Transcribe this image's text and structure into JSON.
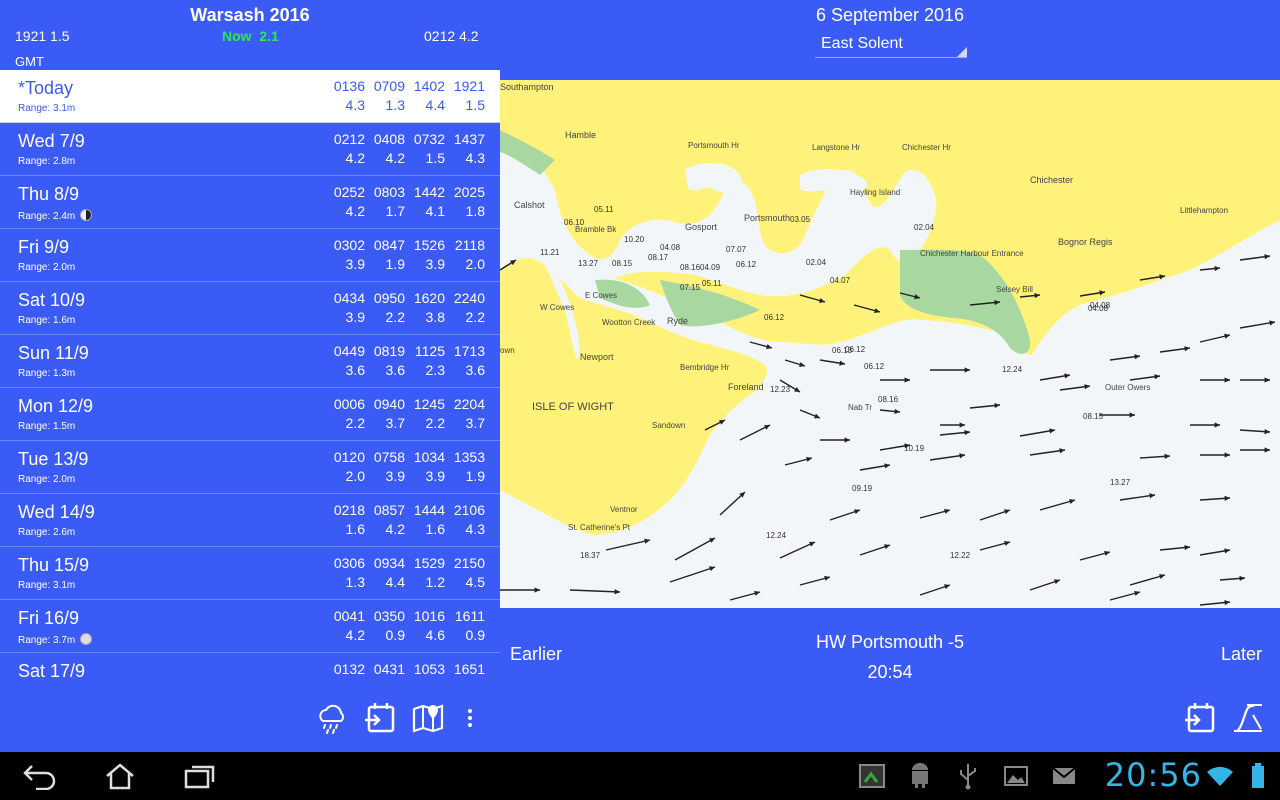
{
  "left": {
    "title": "Warsash 2016",
    "prev_tide": "1921  1.5",
    "now_label": "Now",
    "now_value": "2.1",
    "next_tide": "0212  4.2",
    "timezone": "GMT",
    "days": [
      {
        "name": "*Today",
        "range": "Range: 3.1m",
        "moon": "",
        "times": [
          "0136",
          "0709",
          "1402",
          "1921"
        ],
        "heights": [
          "4.3",
          "1.3",
          "4.4",
          "1.5"
        ]
      },
      {
        "name": "Wed 7/9",
        "range": "Range: 2.8m",
        "moon": "",
        "times": [
          "0212",
          "0408",
          "0732",
          "1437"
        ],
        "heights": [
          "4.2",
          "4.2",
          "1.5",
          "4.3"
        ]
      },
      {
        "name": "Thu 8/9",
        "range": "Range: 2.4m",
        "moon": "new",
        "times": [
          "0252",
          "0803",
          "1442",
          "2025"
        ],
        "heights": [
          "4.2",
          "1.7",
          "4.1",
          "1.8"
        ]
      },
      {
        "name": "Fri 9/9",
        "range": "Range: 2.0m",
        "moon": "",
        "times": [
          "0302",
          "0847",
          "1526",
          "2118"
        ],
        "heights": [
          "3.9",
          "1.9",
          "3.9",
          "2.0"
        ]
      },
      {
        "name": "Sat 10/9",
        "range": "Range: 1.6m",
        "moon": "",
        "times": [
          "0434",
          "0950",
          "1620",
          "2240"
        ],
        "heights": [
          "3.9",
          "2.2",
          "3.8",
          "2.2"
        ]
      },
      {
        "name": "Sun 11/9",
        "range": "Range: 1.3m",
        "moon": "",
        "times": [
          "0449",
          "0819",
          "1125",
          "1713"
        ],
        "heights": [
          "3.6",
          "3.6",
          "2.3",
          "3.6"
        ]
      },
      {
        "name": "Mon 12/9",
        "range": "Range: 1.5m",
        "moon": "",
        "times": [
          "0006",
          "0940",
          "1245",
          "2204"
        ],
        "heights": [
          "2.2",
          "3.7",
          "2.2",
          "3.7"
        ]
      },
      {
        "name": "Tue 13/9",
        "range": "Range: 2.0m",
        "moon": "",
        "times": [
          "0120",
          "0758",
          "1034",
          "1353"
        ],
        "heights": [
          "2.0",
          "3.9",
          "3.9",
          "1.9"
        ]
      },
      {
        "name": "Wed 14/9",
        "range": "Range: 2.6m",
        "moon": "",
        "times": [
          "0218",
          "0857",
          "1444",
          "2106"
        ],
        "heights": [
          "1.6",
          "4.2",
          "1.6",
          "4.3"
        ]
      },
      {
        "name": "Thu 15/9",
        "range": "Range: 3.1m",
        "moon": "",
        "times": [
          "0306",
          "0934",
          "1529",
          "2150"
        ],
        "heights": [
          "1.3",
          "4.4",
          "1.2",
          "4.5"
        ]
      },
      {
        "name": "Fri 16/9",
        "range": "Range: 3.7m",
        "moon": "full",
        "times": [
          "0041",
          "0350",
          "1016",
          "1611"
        ],
        "heights": [
          "4.2",
          "0.9",
          "4.6",
          "0.9"
        ]
      },
      {
        "name": "Sat 17/9",
        "range": "",
        "moon": "",
        "times": [
          "0132",
          "0431",
          "1053",
          "1651"
        ],
        "heights": [
          "",
          "",
          "",
          ""
        ]
      }
    ],
    "toolbar": [
      "weather-icon",
      "calendar-enter-icon",
      "map-icon",
      "overflow-menu-icon"
    ]
  },
  "right": {
    "date": "6 September 2016",
    "area": "East Solent",
    "earlier": "Earlier",
    "later": "Later",
    "hw_label": "HW Portsmouth -5",
    "time": "20:54",
    "map_labels": {
      "southampton": "Southampton",
      "hamble": "Hamble",
      "calshot": "Calshot",
      "gosport": "Gosport",
      "portsmouth_hr": "Portsmouth Hr",
      "portsmouth": "Portsmouth",
      "langstone": "Langstone Hr",
      "hayling": "Hayling Island",
      "chichester_hr": "Chichester Hr",
      "chichester": "Chichester",
      "chichester_entrance": "Chichester Harbour Entrance",
      "littlehampton": "Littlehampton",
      "bognor": "Bognor Regis",
      "selsey": "Selsey Bill",
      "isle_of_wight": "ISLE OF WIGHT",
      "w_cowes": "W Cowes",
      "e_cowes": "E Cowes",
      "wootton": "Wootton Creek",
      "ryde": "Ryde",
      "newport": "Newport",
      "bembridge": "Bembridge Hr",
      "foreland": "Foreland",
      "nab": "Nab Tr",
      "sandown": "Sandown",
      "ventnor": "Ventnor",
      "st_cath": "St. Catherine's Pt",
      "brambles": "Bramble Bk",
      "outer_owers": "Outer Owers",
      "town": "own"
    },
    "map_rates": [
      "05.11",
      "08.16",
      "04.08",
      "10.20",
      "08.17",
      "04.09",
      "06.12",
      "07.07",
      "02.04",
      "03.05",
      "04.08",
      "06.12",
      "04.07",
      "05.11",
      "07.15",
      "06.12",
      "06.13",
      "06.12",
      "12.24",
      "12.23",
      "08.16",
      "10.19",
      "09.19",
      "12.24",
      "13.27",
      "18.37",
      "12.22",
      "04.08",
      "08.15",
      "11.21",
      "13.27",
      "08.15",
      "06.10",
      "02.04"
    ]
  },
  "system": {
    "clock": "20:56",
    "nav": [
      "back-icon",
      "home-icon",
      "recent-apps-icon"
    ],
    "status": [
      "app-screenshot-icon",
      "android-debug-icon",
      "usb-icon",
      "gallery-icon",
      "email-icon",
      "wifi-icon",
      "battery-icon"
    ]
  },
  "colors": {
    "panel": "#3a5bf5",
    "now": "#2ee65a",
    "land": "#fff27a",
    "marsh": "#a8d8a0",
    "sea": "#f2f6f8",
    "clock": "#33b5e5"
  }
}
